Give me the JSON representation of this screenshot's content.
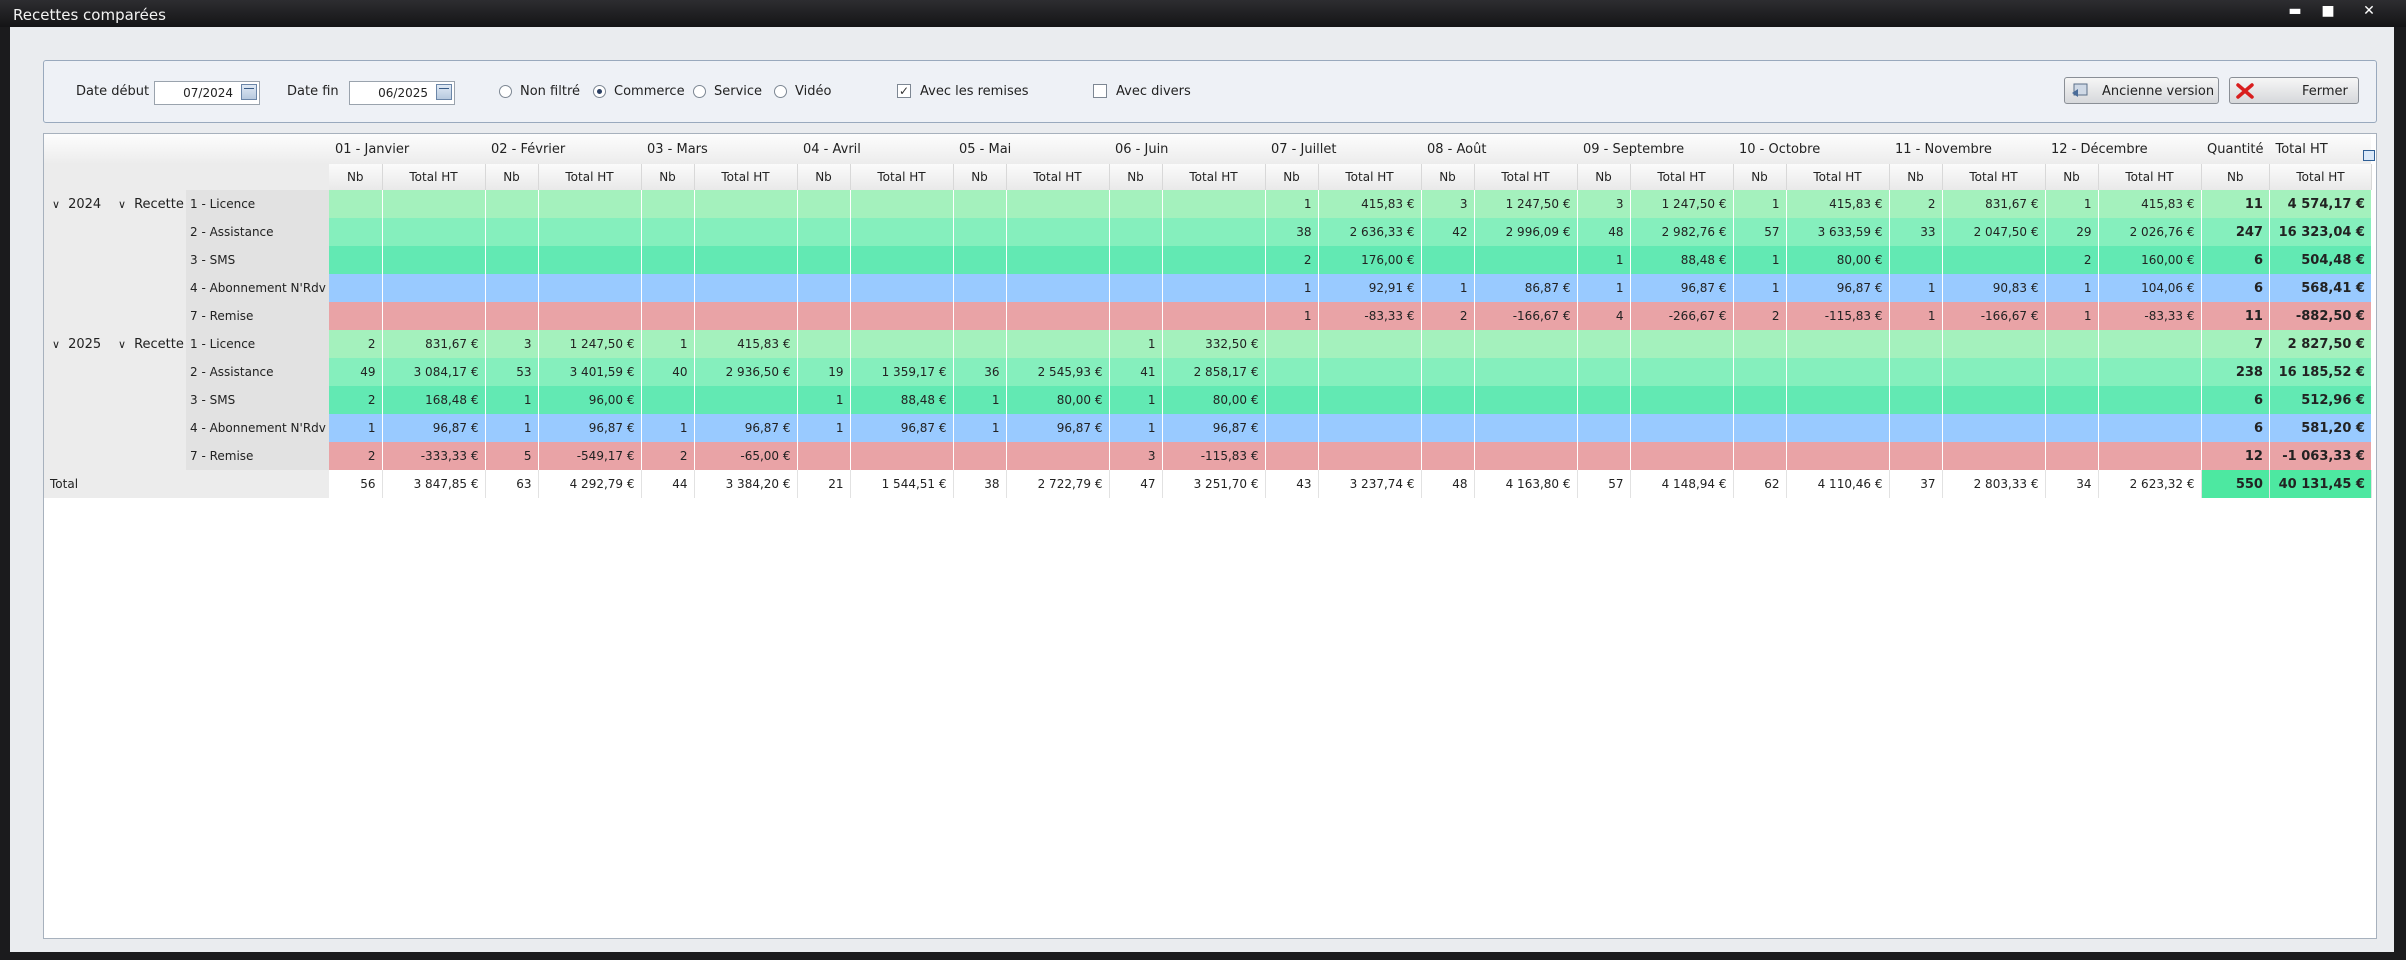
{
  "window": {
    "title": "Recettes comparées",
    "minimize_icon": "▬",
    "maximize_icon": "■",
    "close_icon": "✕"
  },
  "filters": {
    "date_debut_label": "Date début",
    "date_debut_value": "07/2024",
    "date_fin_label": "Date fin",
    "date_fin_value": "06/2025",
    "radio_non_filtre": "Non filtré",
    "radio_commerce": "Commerce",
    "radio_service": "Service",
    "radio_video": "Vidéo",
    "selected_radio": "Commerce",
    "check_remises": "Avec les remises",
    "check_remises_checked": true,
    "check_divers": "Avec divers",
    "check_divers_checked": false
  },
  "buttons": {
    "ancienne_version": "Ancienne version",
    "fermer": "Fermer"
  },
  "grid": {
    "months": [
      "01 - Janvier",
      "02 - Février",
      "03 - Mars",
      "04 - Avril",
      "05 - Mai",
      "06 - Juin",
      "07 - Juillet",
      "08 - Août",
      "09 - Septembre",
      "10 - Octobre",
      "11 - Novembre",
      "12 - Décembre"
    ],
    "sub_nb": "Nb",
    "sub_total": "Total HT",
    "col_quantite": "Quantité",
    "col_total_ht": "Total HT",
    "groups": [
      {
        "year": "2024",
        "type": "Recette",
        "rows": [
          {
            "label": "1 - Licence",
            "kind": "lic",
            "cells": [
              [
                "",
                ""
              ],
              [
                "",
                ""
              ],
              [
                "",
                ""
              ],
              [
                "",
                ""
              ],
              [
                "",
                ""
              ],
              [
                "",
                ""
              ],
              [
                "1",
                "415,83 €"
              ],
              [
                "3",
                "1 247,50 €"
              ],
              [
                "3",
                "1 247,50 €"
              ],
              [
                "1",
                "415,83 €"
              ],
              [
                "2",
                "831,67 €"
              ],
              [
                "1",
                "415,83 €"
              ]
            ],
            "qty": "11",
            "total": "4 574,17 €"
          },
          {
            "label": "2 - Assistance",
            "kind": "asi",
            "cells": [
              [
                "",
                ""
              ],
              [
                "",
                ""
              ],
              [
                "",
                ""
              ],
              [
                "",
                ""
              ],
              [
                "",
                ""
              ],
              [
                "",
                ""
              ],
              [
                "38",
                "2 636,33 €"
              ],
              [
                "42",
                "2 996,09 €"
              ],
              [
                "48",
                "2 982,76 €"
              ],
              [
                "57",
                "3 633,59 €"
              ],
              [
                "33",
                "2 047,50 €"
              ],
              [
                "29",
                "2 026,76 €"
              ]
            ],
            "qty": "247",
            "total": "16 323,04 €"
          },
          {
            "label": "3 - SMS",
            "kind": "sms",
            "cells": [
              [
                "",
                ""
              ],
              [
                "",
                ""
              ],
              [
                "",
                ""
              ],
              [
                "",
                ""
              ],
              [
                "",
                ""
              ],
              [
                "",
                ""
              ],
              [
                "2",
                "176,00 €"
              ],
              [
                "",
                ""
              ],
              [
                "1",
                "88,48 €"
              ],
              [
                "1",
                "80,00 €"
              ],
              [
                "",
                ""
              ],
              [
                "2",
                "160,00 €"
              ]
            ],
            "qty": "6",
            "total": "504,48 €"
          },
          {
            "label": "4 - Abonnement N'Rdv",
            "kind": "abo",
            "cells": [
              [
                "",
                ""
              ],
              [
                "",
                ""
              ],
              [
                "",
                ""
              ],
              [
                "",
                ""
              ],
              [
                "",
                ""
              ],
              [
                "",
                ""
              ],
              [
                "1",
                "92,91 €"
              ],
              [
                "1",
                "86,87 €"
              ],
              [
                "1",
                "96,87 €"
              ],
              [
                "1",
                "96,87 €"
              ],
              [
                "1",
                "90,83 €"
              ],
              [
                "1",
                "104,06 €"
              ]
            ],
            "qty": "6",
            "total": "568,41 €"
          },
          {
            "label": "7 - Remise",
            "kind": "rem",
            "cells": [
              [
                "",
                ""
              ],
              [
                "",
                ""
              ],
              [
                "",
                ""
              ],
              [
                "",
                ""
              ],
              [
                "",
                ""
              ],
              [
                "",
                ""
              ],
              [
                "1",
                "-83,33 €"
              ],
              [
                "2",
                "-166,67 €"
              ],
              [
                "4",
                "-266,67 €"
              ],
              [
                "2",
                "-115,83 €"
              ],
              [
                "1",
                "-166,67 €"
              ],
              [
                "1",
                "-83,33 €"
              ]
            ],
            "qty": "11",
            "total": "-882,50 €"
          }
        ]
      },
      {
        "year": "2025",
        "type": "Recette",
        "rows": [
          {
            "label": "1 - Licence",
            "kind": "lic",
            "cells": [
              [
                "2",
                "831,67 €"
              ],
              [
                "3",
                "1 247,50 €"
              ],
              [
                "1",
                "415,83 €"
              ],
              [
                "",
                ""
              ],
              [
                "",
                ""
              ],
              [
                "1",
                "332,50 €"
              ],
              [
                "",
                ""
              ],
              [
                "",
                ""
              ],
              [
                "",
                ""
              ],
              [
                "",
                ""
              ],
              [
                "",
                ""
              ],
              [
                "",
                ""
              ]
            ],
            "qty": "7",
            "total": "2 827,50 €"
          },
          {
            "label": "2 - Assistance",
            "kind": "asi",
            "cells": [
              [
                "49",
                "3 084,17 €"
              ],
              [
                "53",
                "3 401,59 €"
              ],
              [
                "40",
                "2 936,50 €"
              ],
              [
                "19",
                "1 359,17 €"
              ],
              [
                "36",
                "2 545,93 €"
              ],
              [
                "41",
                "2 858,17 €"
              ],
              [
                "",
                ""
              ],
              [
                "",
                ""
              ],
              [
                "",
                ""
              ],
              [
                "",
                ""
              ],
              [
                "",
                ""
              ],
              [
                "",
                ""
              ]
            ],
            "qty": "238",
            "total": "16 185,52 €"
          },
          {
            "label": "3 - SMS",
            "kind": "sms",
            "cells": [
              [
                "2",
                "168,48 €"
              ],
              [
                "1",
                "96,00 €"
              ],
              [
                "",
                ""
              ],
              [
                "1",
                "88,48 €"
              ],
              [
                "1",
                "80,00 €"
              ],
              [
                "1",
                "80,00 €"
              ],
              [
                "",
                ""
              ],
              [
                "",
                ""
              ],
              [
                "",
                ""
              ],
              [
                "",
                ""
              ],
              [
                "",
                ""
              ],
              [
                "",
                ""
              ]
            ],
            "qty": "6",
            "total": "512,96 €"
          },
          {
            "label": "4 - Abonnement N'Rdv",
            "kind": "abo",
            "cells": [
              [
                "1",
                "96,87 €"
              ],
              [
                "1",
                "96,87 €"
              ],
              [
                "1",
                "96,87 €"
              ],
              [
                "1",
                "96,87 €"
              ],
              [
                "1",
                "96,87 €"
              ],
              [
                "1",
                "96,87 €"
              ],
              [
                "",
                ""
              ],
              [
                "",
                ""
              ],
              [
                "",
                ""
              ],
              [
                "",
                ""
              ],
              [
                "",
                ""
              ],
              [
                "",
                ""
              ]
            ],
            "qty": "6",
            "total": "581,20 €"
          },
          {
            "label": "7 - Remise",
            "kind": "rem",
            "cells": [
              [
                "2",
                "-333,33 €"
              ],
              [
                "5",
                "-549,17 €"
              ],
              [
                "2",
                "-65,00 €"
              ],
              [
                "",
                ""
              ],
              [
                "",
                ""
              ],
              [
                "3",
                "-115,83 €"
              ],
              [
                "",
                ""
              ],
              [
                "",
                ""
              ],
              [
                "",
                ""
              ],
              [
                "",
                ""
              ],
              [
                "",
                ""
              ],
              [
                "",
                ""
              ]
            ],
            "qty": "12",
            "total": "-1 063,33 €"
          }
        ]
      }
    ],
    "total_row": {
      "label": "Total",
      "cells": [
        [
          "56",
          "3 847,85 €"
        ],
        [
          "63",
          "4 292,79 €"
        ],
        [
          "44",
          "3 384,20 €"
        ],
        [
          "21",
          "1 544,51 €"
        ],
        [
          "38",
          "2 722,79 €"
        ],
        [
          "47",
          "3 251,70 €"
        ],
        [
          "43",
          "3 237,74 €"
        ],
        [
          "48",
          "4 163,80 €"
        ],
        [
          "57",
          "4 148,94 €"
        ],
        [
          "62",
          "4 110,46 €"
        ],
        [
          "37",
          "2 803,33 €"
        ],
        [
          "34",
          "2 623,32 €"
        ]
      ],
      "qty": "550",
      "total": "40 131,45 €"
    }
  }
}
